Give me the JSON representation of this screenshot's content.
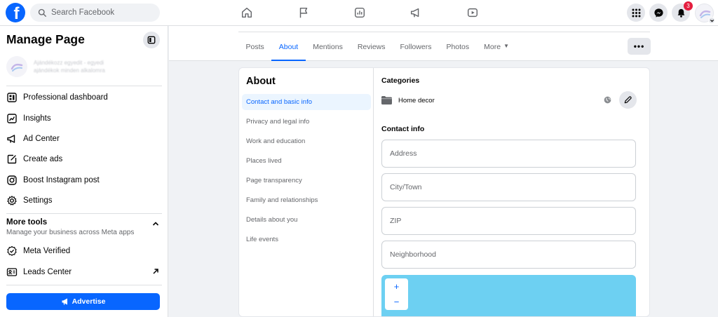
{
  "topbar": {
    "logo": "f",
    "search_placeholder": "Search Facebook",
    "nav_icons": [
      "home-icon",
      "flag-icon",
      "insights-icon",
      "megaphone-icon",
      "video-icon"
    ],
    "notification_count": "3"
  },
  "sidebar": {
    "title": "Manage Page",
    "page_name_line1": "Ajándékozz egyedit - egyedi",
    "page_name_line2": "ajándékok minden alkalomra",
    "items": [
      {
        "label": "Professional dashboard",
        "icon": "dashboard-icon"
      },
      {
        "label": "Insights",
        "icon": "insights-icon"
      },
      {
        "label": "Ad Center",
        "icon": "megaphone-icon"
      },
      {
        "label": "Create ads",
        "icon": "edit-icon"
      },
      {
        "label": "Boost Instagram post",
        "icon": "instagram-icon"
      },
      {
        "label": "Settings",
        "icon": "gear-icon"
      }
    ],
    "more_tools": {
      "title": "More tools",
      "subtitle": "Manage your business across Meta apps"
    },
    "tool_items": [
      {
        "label": "Meta Verified",
        "icon": "verified-icon"
      },
      {
        "label": "Leads Center",
        "icon": "contact-card-icon"
      }
    ],
    "advertise_label": "Advertise"
  },
  "tabs": [
    {
      "label": "Posts"
    },
    {
      "label": "About"
    },
    {
      "label": "Mentions"
    },
    {
      "label": "Reviews"
    },
    {
      "label": "Followers"
    },
    {
      "label": "Photos"
    },
    {
      "label": "More"
    }
  ],
  "active_tab": "About",
  "more_options_label": "•••",
  "about": {
    "title": "About",
    "nav": [
      "Contact and basic info",
      "Privacy and legal info",
      "Work and education",
      "Places lived",
      "Page transparency",
      "Family and relationships",
      "Details about you",
      "Life events"
    ],
    "active_nav": "Contact and basic info",
    "categories_title": "Categories",
    "category": "Home decor",
    "contact_title": "Contact info",
    "fields": [
      {
        "placeholder": "Address",
        "value": ""
      },
      {
        "placeholder": "City/Town",
        "value": ""
      },
      {
        "placeholder": "ZIP",
        "value": ""
      },
      {
        "placeholder": "Neighborhood",
        "value": ""
      }
    ],
    "map": {
      "zoom_in": "+",
      "zoom_out": "−"
    }
  },
  "colors": {
    "accent": "#0866ff",
    "badge": "#e41e3f",
    "map_water": "#6dd0f2",
    "page_bg": "#f0f2f5"
  }
}
